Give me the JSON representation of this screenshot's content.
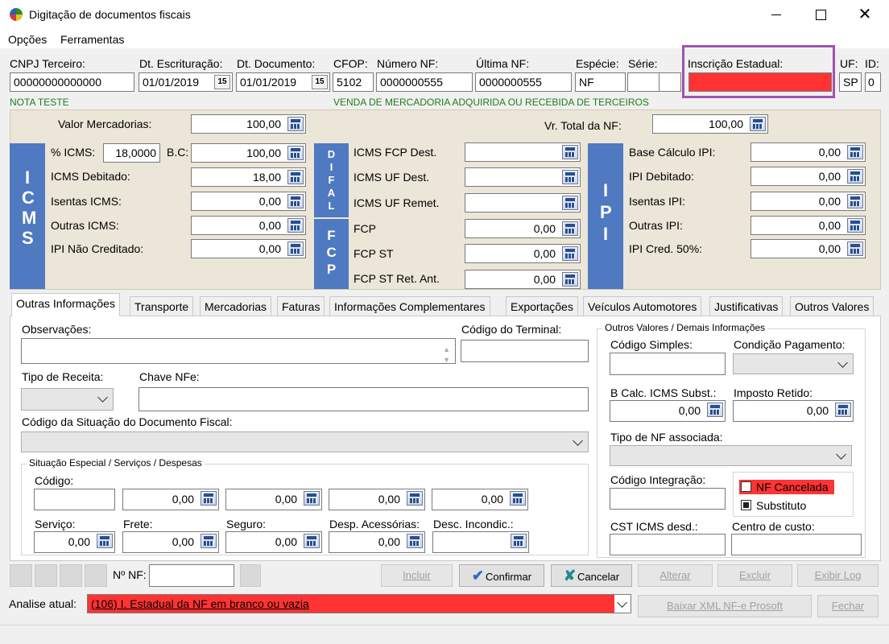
{
  "window": {
    "title": "Digitação de documentos fiscais"
  },
  "menu": {
    "opcoes": "Opções",
    "ferramentas": "Ferramentas"
  },
  "header": {
    "cnpj_label": "CNPJ Terceiro:",
    "cnpj_value": "00000000000000",
    "dt_escrit_label": "Dt. Escrituração:",
    "dt_escrit_value": "01/01/2019",
    "dt_doc_label": "Dt. Documento:",
    "dt_doc_value": "01/01/2019",
    "cfop_label": "CFOP:",
    "cfop_value": "5102",
    "numero_label": "Número NF:",
    "numero_value": "0000000555",
    "ultima_label": "Última NF:",
    "ultima_value": "0000000555",
    "especie_label": "Espécie:",
    "especie_value": "NF",
    "serie_label": "Série:",
    "ie_label": "Inscrição Estadual:",
    "uf_label": "UF:",
    "uf_value": "SP",
    "id_label": "ID:",
    "id_value": "0",
    "nota_desc": "NOTA TESTE",
    "cfop_desc": "VENDA DE MERCADORIA ADQUIRIDA OU RECEBIDA DE TERCEIROS",
    "calendar_glyph": "15"
  },
  "totals": {
    "valor_merc_label": "Valor Mercadorias:",
    "valor_merc_value": "100,00",
    "vr_total_label": "Vr. Total da NF:",
    "vr_total_value": "100,00"
  },
  "icms": {
    "bar": "I C M S",
    "pct_label": "% ICMS:",
    "pct_value": "18,0000",
    "bc_label": "B.C:",
    "bc_value": "100,00",
    "debitado_label": "ICMS Debitado:",
    "debitado_value": "18,00",
    "isentas_label": "Isentas ICMS:",
    "isentas_value": "0,00",
    "outras_label": "Outras ICMS:",
    "outras_value": "0,00",
    "ipi_nao_label": "IPI Não Creditado:",
    "ipi_nao_value": "0,00"
  },
  "difal": {
    "bar": "D I F A L",
    "fcp_dest_label": "ICMS FCP Dest.",
    "fcp_dest_value": "",
    "uf_dest_label": "ICMS UF Dest.",
    "uf_dest_value": "",
    "uf_remet_label": "ICMS UF Remet.",
    "uf_remet_value": ""
  },
  "fcp": {
    "bar": "F C P",
    "fcp_label": "FCP",
    "fcp_value": "0,00",
    "fcp_st_label": "FCP ST",
    "fcp_st_value": "0,00",
    "fcp_st_ret_label": "FCP ST Ret. Ant.",
    "fcp_st_ret_value": "0,00"
  },
  "ipi": {
    "bar": "I P I",
    "base_label": "Base Cálculo IPI:",
    "base_value": "0,00",
    "debitado_label": "IPI Debitado:",
    "debitado_value": "0,00",
    "isentas_label": "Isentas IPI:",
    "isentas_value": "0,00",
    "outras_label": "Outras IPI:",
    "outras_value": "0,00",
    "cred_label": "IPI Cred. 50%:",
    "cred_value": "0,00"
  },
  "tabs": [
    "Outras Informações",
    "Transporte",
    "Mercadorias",
    "Faturas",
    "Informações Complementares",
    "Exportações",
    "Veículos Automotores",
    "Justificativas",
    "Outros Valores"
  ],
  "outras": {
    "obs_label": "Observações:",
    "cod_terminal_label": "Código do Terminal:",
    "tipo_receita_label": "Tipo de Receita:",
    "chave_label": "Chave NFe:",
    "cod_situacao_label": "Código da Situação do Documento Fiscal:",
    "situacao_group": "Situação Especial / Serviços / Despesas",
    "codigo_label": "Código:",
    "extra_values": [
      "0,00",
      "0,00",
      "0,00",
      "0,00"
    ],
    "servico_label": "Serviço:",
    "servico_value": "0,00",
    "frete_label": "Frete:",
    "frete_value": "0,00",
    "seguro_label": "Seguro:",
    "seguro_value": "0,00",
    "desp_label": "Desp. Acessórias:",
    "desp_value": "0,00",
    "desc_label": "Desc. Incondic.:"
  },
  "demais": {
    "group": "Outros Valores / Demais Informações",
    "cod_simples_label": "Código Simples:",
    "cond_pag_label": "Condição Pagamento:",
    "bcalc_label": "B Calc. ICMS Subst.:",
    "bcalc_value": "0,00",
    "imp_retido_label": "Imposto Retido:",
    "imp_retido_value": "0,00",
    "tipo_nf_label": "Tipo de NF associada:",
    "cod_integracao_label": "Código Integração:",
    "nf_cancelada_label": "NF Cancelada",
    "substituto_label": "Substituto",
    "cst_label": "CST ICMS desd.:",
    "centro_label": "Centro de custo:"
  },
  "footer": {
    "nnf_label": "Nº NF:",
    "incluir": "Incluir",
    "confirmar": "Confirmar",
    "cancelar": "Cancelar",
    "alterar": "Alterar",
    "excluir": "Excluir",
    "exibir_log": "Exibir Log",
    "baixar_xml": "Baixar XML NF-e Prosoft",
    "fechar": "Fechar",
    "analise_label": "Analise atual:",
    "analise_value": "(106) I. Estadual da NF em branco ou vazia"
  },
  "colors": {
    "error_red": "#ff3333",
    "bar_blue": "#4f79c0",
    "highlight_purple": "#a052b0",
    "green_text": "#1a7f1a"
  }
}
